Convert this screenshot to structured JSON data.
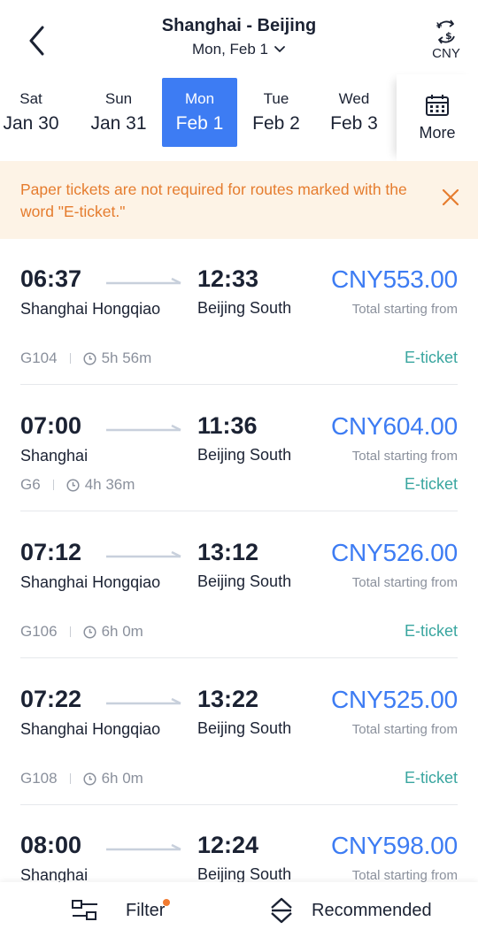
{
  "header": {
    "title": "Shanghai - Beijing",
    "subtitle": "Mon, Feb 1",
    "currency": "CNY"
  },
  "dates": [
    {
      "dow": "Sat",
      "date": "Jan 30",
      "selected": false
    },
    {
      "dow": "Sun",
      "date": "Jan 31",
      "selected": false
    },
    {
      "dow": "Mon",
      "date": "Feb 1",
      "selected": true
    },
    {
      "dow": "Tue",
      "date": "Feb 2",
      "selected": false
    },
    {
      "dow": "Wed",
      "date": "Feb 3",
      "selected": false
    }
  ],
  "more_label": "More",
  "notice": {
    "text": "Paper tickets are not required for routes marked with the word \"E-ticket.\""
  },
  "trains": [
    {
      "dep_time": "06:37",
      "dep_station": "Shanghai Hongqiao",
      "arr_time": "12:33",
      "arr_station": "Beijing South",
      "price": "CNY553.00",
      "price_note": "Total starting from",
      "number": "G104",
      "duration": "5h 56m",
      "ticket_type": "E-ticket"
    },
    {
      "dep_time": "07:00",
      "dep_station": "Shanghai",
      "arr_time": "11:36",
      "arr_station": "Beijing South",
      "price": "CNY604.00",
      "price_note": "Total starting from",
      "number": "G6",
      "duration": "4h 36m",
      "ticket_type": "E-ticket"
    },
    {
      "dep_time": "07:12",
      "dep_station": "Shanghai Hongqiao",
      "arr_time": "13:12",
      "arr_station": "Beijing South",
      "price": "CNY526.00",
      "price_note": "Total starting from",
      "number": "G106",
      "duration": "6h 0m",
      "ticket_type": "E-ticket"
    },
    {
      "dep_time": "07:22",
      "dep_station": "Shanghai Hongqiao",
      "arr_time": "13:22",
      "arr_station": "Beijing South",
      "price": "CNY525.00",
      "price_note": "Total starting from",
      "number": "G108",
      "duration": "6h 0m",
      "ticket_type": "E-ticket"
    },
    {
      "dep_time": "08:00",
      "dep_station": "Shanghai",
      "arr_time": "12:24",
      "arr_station": "Beijing South",
      "price": "CNY598.00",
      "price_note": "Total starting from",
      "number": "",
      "duration": "",
      "ticket_type": ""
    }
  ],
  "bottom": {
    "filter_label": "Filter",
    "sort_label": "Recommended"
  },
  "colors": {
    "accent": "#3d7cf3",
    "notice_bg": "#fdf3e6",
    "notice_text": "#e57c2e",
    "eticket": "#3aa6a0",
    "filter_dot": "#f07a30"
  },
  "icons": {
    "back": "chevron-left-icon",
    "currency": "currency-exchange-icon",
    "calendar": "calendar-icon",
    "close": "close-icon",
    "clock": "clock-icon",
    "filter": "filter-icon",
    "sort": "sort-icon"
  }
}
